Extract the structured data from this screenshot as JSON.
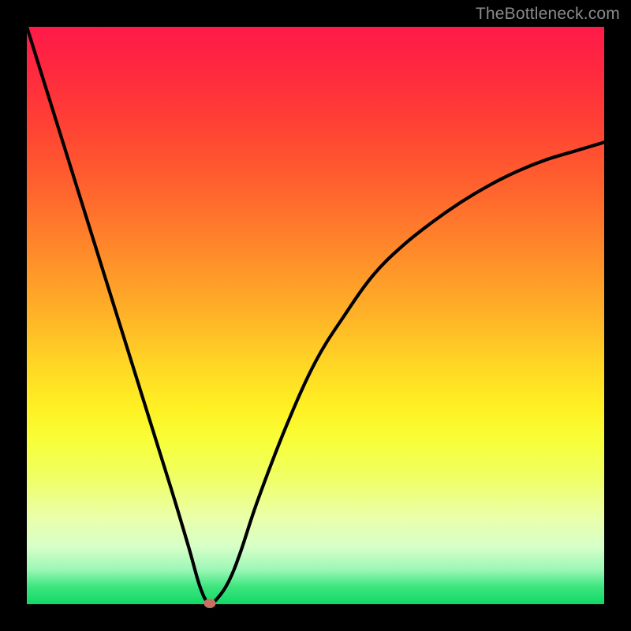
{
  "watermark": "TheBottleneck.com",
  "colors": {
    "frame": "#000000",
    "curve": "#000000",
    "marker": "#c77061"
  },
  "chart_data": {
    "type": "line",
    "title": "",
    "xlabel": "",
    "ylabel": "",
    "xlim": [
      0,
      100
    ],
    "ylim": [
      0,
      100
    ],
    "grid": false,
    "legend": false,
    "series": [
      {
        "name": "bottleneck-curve",
        "x": [
          0,
          5,
          10,
          15,
          20,
          25,
          28,
          30,
          31.5,
          33,
          35,
          37,
          40,
          45,
          50,
          55,
          60,
          65,
          70,
          75,
          80,
          85,
          90,
          95,
          100
        ],
        "y": [
          100,
          84,
          68,
          52,
          36,
          20,
          10,
          3,
          0.2,
          1,
          4,
          9,
          18,
          31,
          42,
          50,
          57,
          62,
          66,
          69.5,
          72.5,
          75,
          77,
          78.5,
          80
        ]
      }
    ],
    "marker": {
      "x": 31.7,
      "y": 0.2
    },
    "background_gradient": [
      "#ff1a49",
      "#ff4433",
      "#ff8e2a",
      "#ffd425",
      "#fff123",
      "#eaffaa",
      "#9cf7b7",
      "#11d867"
    ]
  }
}
